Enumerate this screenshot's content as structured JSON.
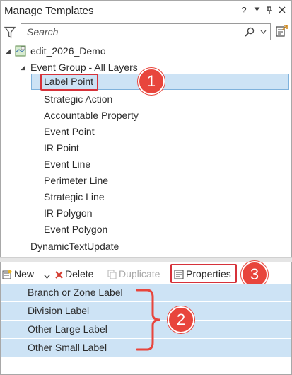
{
  "window": {
    "title": "Manage Templates",
    "help_glyph": "?",
    "menu_glyph": "▾",
    "pin_glyph": "ᛘ",
    "close_glyph": "✕"
  },
  "search": {
    "placeholder": "Search",
    "value": ""
  },
  "tree": {
    "map_name": "edit_2026_Demo",
    "group_name": "Event Group - All Layers",
    "items": [
      "Label Point",
      "Strategic Action",
      "Accountable Property",
      "Event Point",
      "IR Point",
      "Event Line",
      "Perimeter Line",
      "Strategic Line",
      "IR Polygon",
      "Event Polygon"
    ],
    "other_layer": "DynamicTextUpdate",
    "selected_index": 0
  },
  "toolbar": {
    "new_label": "New",
    "delete_label": "Delete",
    "duplicate_label": "Duplicate",
    "properties_label": "Properties"
  },
  "list": {
    "items": [
      "Branch or Zone Label",
      "Division Label",
      "Other Large Label",
      "Other Small Label"
    ]
  },
  "callouts": {
    "one": "1",
    "two": "2",
    "three": "3"
  },
  "colors": {
    "selection": "#cde3f5",
    "callout_red": "#e8453c",
    "highlight_border": "#d6323a"
  }
}
